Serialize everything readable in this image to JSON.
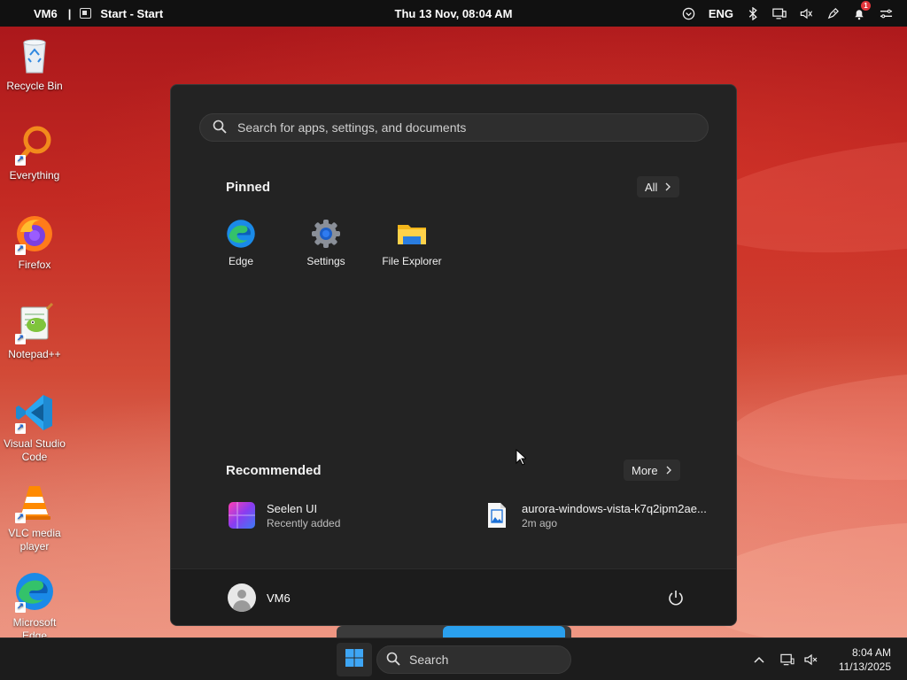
{
  "topbar": {
    "workspace": "VM6",
    "separator": "|",
    "window_title": "Start - Start",
    "datetime": "Thu 13 Nov, 08:04 AM",
    "language": "ENG",
    "notification_count": "1"
  },
  "desktop": {
    "icons": [
      {
        "label": "Recycle Bin",
        "icon": "recycle-bin-icon"
      },
      {
        "label": "Everything",
        "icon": "everything-search-icon"
      },
      {
        "label": "Firefox",
        "icon": "firefox-icon"
      },
      {
        "label": "Notepad++",
        "icon": "notepad-plus-plus-icon"
      },
      {
        "label": "Visual Studio Code",
        "icon": "vscode-icon"
      },
      {
        "label": "VLC media player",
        "icon": "vlc-icon"
      },
      {
        "label": "Microsoft Edge",
        "icon": "edge-icon"
      }
    ]
  },
  "start": {
    "search_placeholder": "Search for apps, settings, and documents",
    "pinned_title": "Pinned",
    "all_label": "All",
    "pinned": [
      {
        "label": "Edge",
        "icon": "edge-icon"
      },
      {
        "label": "Settings",
        "icon": "settings-gear-icon"
      },
      {
        "label": "File Explorer",
        "icon": "folder-icon"
      }
    ],
    "recommended_title": "Recommended",
    "more_label": "More",
    "recommended": [
      {
        "title": "Seelen UI",
        "subtitle": "Recently added",
        "icon": "seelen-ui-icon"
      },
      {
        "title": "aurora-windows-vista-k7q2ipm2ae...",
        "subtitle": "2m ago",
        "icon": "image-file-icon"
      }
    ],
    "user_name": "VM6"
  },
  "taskbar": {
    "search_label": "Search",
    "time": "8:04 AM",
    "date": "11/13/2025"
  },
  "colors": {
    "start_bg": "#232323",
    "taskbar_bg": "#1c1c1c",
    "accent_blue": "#1a8ae8"
  }
}
